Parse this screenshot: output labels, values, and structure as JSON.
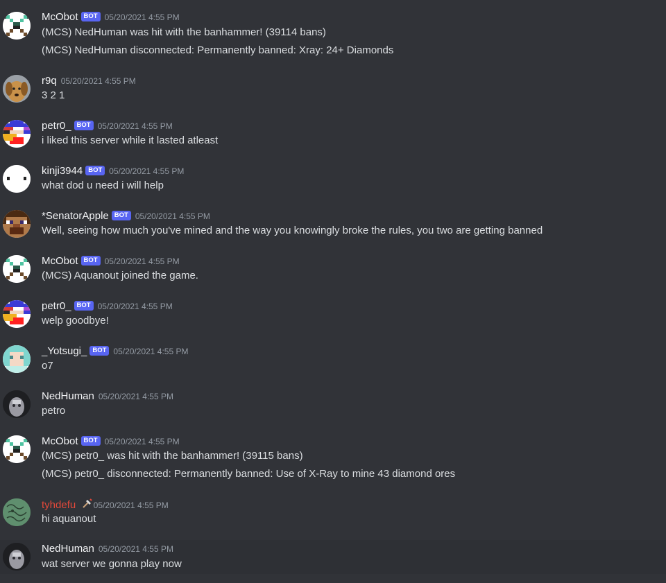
{
  "bot_badge": "BOT",
  "messages": [
    {
      "author": "McObot",
      "time": "05/20/2021 4:55 PM",
      "lines": [
        "(MCS) NedHuman was hit with the banhammer! (39114 bans)",
        "(MCS) NedHuman disconnected: Permanently banned: Xray: 24+ Diamonds"
      ]
    },
    {
      "author": "r9q",
      "time": "05/20/2021 4:55 PM",
      "lines": [
        "3 2 1"
      ]
    },
    {
      "author": "petr0_",
      "time": "05/20/2021 4:55 PM",
      "lines": [
        "i liked this server while it lasted atleast"
      ]
    },
    {
      "author": "kinji3944",
      "time": "05/20/2021 4:55 PM",
      "lines": [
        "what dod u need i will help"
      ]
    },
    {
      "author": "*SenatorApple",
      "time": "05/20/2021 4:55 PM",
      "lines": [
        "Well, seeing how much you've mined and the way you knowingly broke the rules, you two are getting banned"
      ]
    },
    {
      "author": "McObot",
      "time": "05/20/2021 4:55 PM",
      "lines": [
        "(MCS) Aquanout joined the game."
      ]
    },
    {
      "author": "petr0_",
      "time": "05/20/2021 4:55 PM",
      "lines": [
        "welp goodbye!"
      ]
    },
    {
      "author": "_Yotsugi_",
      "time": "05/20/2021 4:55 PM",
      "lines": [
        "o7"
      ]
    },
    {
      "author": "NedHuman",
      "time": "05/20/2021 4:55 PM",
      "lines": [
        "petro"
      ]
    },
    {
      "author": "McObot",
      "time": "05/20/2021 4:55 PM",
      "lines": [
        "(MCS) petr0_ was hit with the banhammer! (39115 bans)",
        "(MCS) petr0_ disconnected: Permanently banned: Use of X-Ray to mine 43 diamond ores"
      ]
    },
    {
      "author": "tyhdefu",
      "time": "05/20/2021 4:55 PM",
      "lines": [
        "hi aquanout"
      ]
    },
    {
      "author": "NedHuman",
      "time": "05/20/2021 4:55 PM",
      "lines": [
        "wat server we gonna play now"
      ]
    }
  ]
}
